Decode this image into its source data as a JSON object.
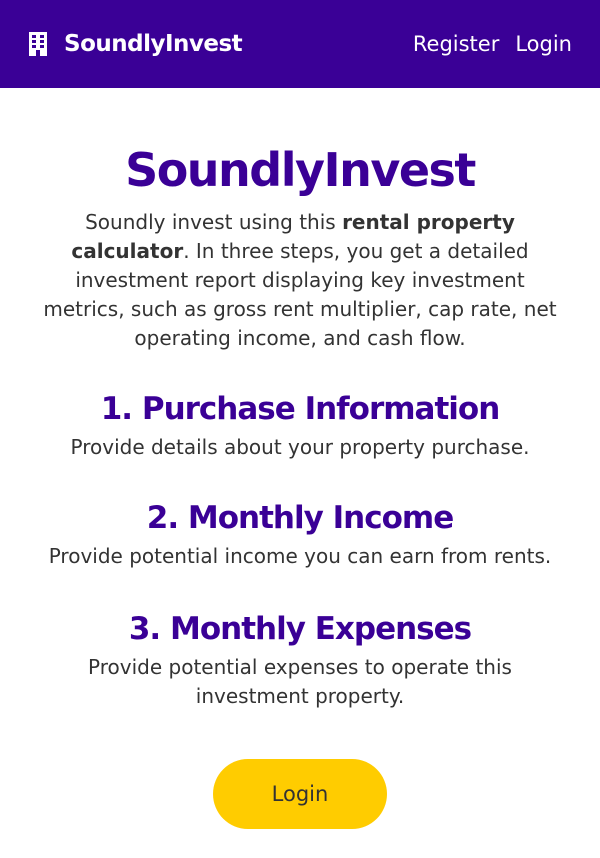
{
  "navbar": {
    "brand_icon": "building-icon",
    "brand_text": "SoundlyInvest",
    "register_label": "Register",
    "login_label": "Login"
  },
  "main": {
    "title": "SoundlyInvest",
    "intro": {
      "before": "Soundly invest using this ",
      "emphasis": "rental property calculator",
      "after": ". In three steps, you get a detailed investment report displaying key investment metrics, such as gross rent multiplier, cap rate, net operating income, and cash flow."
    },
    "steps": [
      {
        "title": "1. Purchase Information",
        "description": "Provide details about your property purchase."
      },
      {
        "title": "2. Monthly Income",
        "description": "Provide potential income you can earn from rents."
      },
      {
        "title": "3. Monthly Expenses",
        "description": "Provide potential expenses to operate this investment property."
      }
    ],
    "cta_label": "Login"
  },
  "colors": {
    "brand_purple": "#3a0096",
    "accent_yellow": "#ffcc00",
    "text": "#333333"
  }
}
